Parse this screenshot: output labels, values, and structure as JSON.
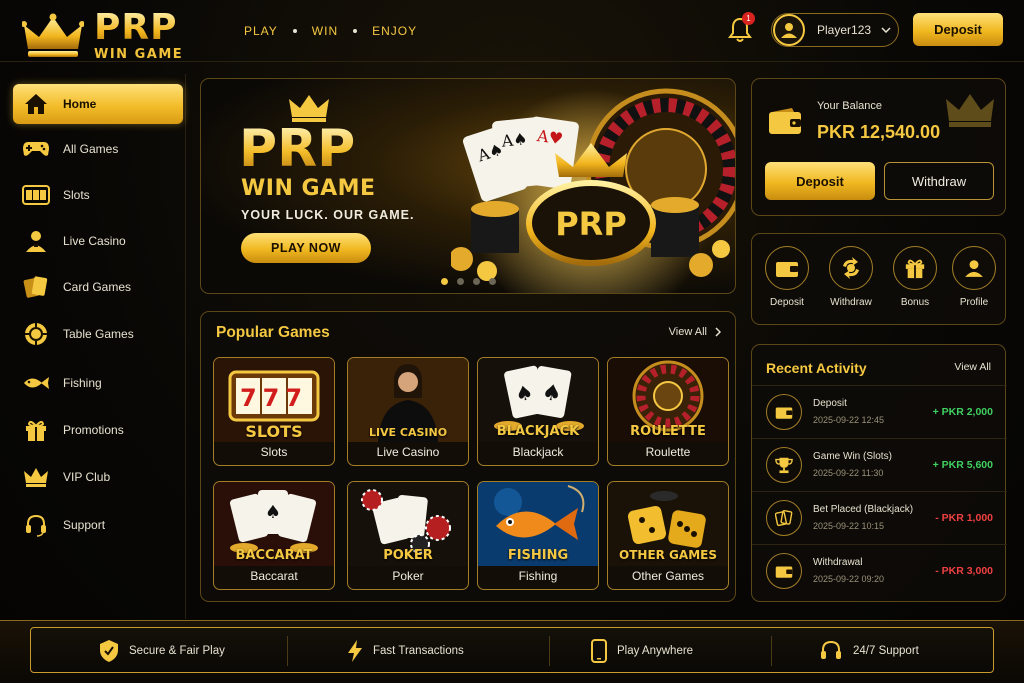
{
  "brand": {
    "name": "PRP",
    "subtitle": "WIN GAME"
  },
  "header": {
    "tagline": [
      "PLAY",
      "WIN",
      "ENJOY"
    ],
    "notification_count": "1",
    "username": "Player123",
    "deposit_label": "Deposit"
  },
  "sidebar": {
    "items": [
      {
        "label": "Home",
        "icon": "home-icon",
        "active": true
      },
      {
        "label": "All Games",
        "icon": "gamepad-icon"
      },
      {
        "label": "Slots",
        "icon": "slot-machine-icon"
      },
      {
        "label": "Live Casino",
        "icon": "dealer-icon"
      },
      {
        "label": "Card Games",
        "icon": "cards-icon"
      },
      {
        "label": "Table Games",
        "icon": "chip-icon"
      },
      {
        "label": "Fishing",
        "icon": "fish-icon"
      },
      {
        "label": "Promotions",
        "icon": "gift-icon"
      },
      {
        "label": "VIP Club",
        "icon": "crown-icon"
      },
      {
        "label": "Support",
        "icon": "headset-icon"
      }
    ]
  },
  "hero": {
    "title": "PRP",
    "subtitle": "WIN GAME",
    "tagline": "YOUR LUCK. OUR GAME.",
    "cta": "PLAY NOW",
    "emblem": "PRP",
    "slides_total": 4,
    "slide_active": 1
  },
  "balance": {
    "label": "Your Balance",
    "value": "PKR 12,540.00",
    "deposit": "Deposit",
    "withdraw": "Withdraw"
  },
  "quick_actions": [
    {
      "label": "Deposit",
      "icon": "wallet-icon"
    },
    {
      "label": "Withdraw",
      "icon": "exchange-icon"
    },
    {
      "label": "Bonus",
      "icon": "gift-icon"
    },
    {
      "label": "Profile",
      "icon": "user-icon"
    }
  ],
  "popular": {
    "title": "Popular Games",
    "view_all": "View All",
    "games": [
      {
        "banner": "SLOTS",
        "name": "Slots",
        "icon": "slot-machine-icon"
      },
      {
        "banner": "LIVE CASINO",
        "name": "Live Casino",
        "icon": "dealer-icon"
      },
      {
        "banner": "BLACKJACK",
        "name": "Blackjack",
        "icon": "cards-icon"
      },
      {
        "banner": "ROULETTE",
        "name": "Roulette",
        "icon": "roulette-icon"
      },
      {
        "banner": "BACCARAT",
        "name": "Baccarat",
        "icon": "cards-icon"
      },
      {
        "banner": "POKER",
        "name": "Poker",
        "icon": "poker-chips-icon"
      },
      {
        "banner": "FISHING",
        "name": "Fishing",
        "icon": "fish-icon"
      },
      {
        "banner": "OTHER GAMES",
        "name": "Other Games",
        "icon": "dice-icon"
      }
    ],
    "slot_reels": "777"
  },
  "activity": {
    "title": "Recent Activity",
    "view_all": "View All",
    "rows": [
      {
        "title": "Deposit",
        "date": "2025-09-22 12:45",
        "amount": "+ PKR 2,000",
        "kind": "pos",
        "icon": "wallet-icon"
      },
      {
        "title": "Game Win (Slots)",
        "date": "2025-09-22 11:30",
        "amount": "+ PKR 5,600",
        "kind": "pos",
        "icon": "trophy-icon"
      },
      {
        "title": "Bet Placed (Blackjack)",
        "date": "2025-09-22 10:15",
        "amount": "- PKR 1,000",
        "kind": "neg",
        "icon": "cards-icon"
      },
      {
        "title": "Withdrawal",
        "date": "2025-09-22 09:20",
        "amount": "- PKR 3,000",
        "kind": "neg",
        "icon": "wallet-icon"
      }
    ]
  },
  "footer": {
    "features": [
      {
        "label": "Secure & Fair Play",
        "icon": "shield-icon"
      },
      {
        "label": "Fast Transactions",
        "icon": "lightning-icon"
      },
      {
        "label": "Play Anywhere",
        "icon": "phone-icon"
      },
      {
        "label": "24/7 Support",
        "icon": "headset-icon"
      }
    ]
  },
  "colors": {
    "accent": "#f5c842",
    "positive": "#3fd061",
    "negative": "#ef4040",
    "background": "#080705"
  }
}
